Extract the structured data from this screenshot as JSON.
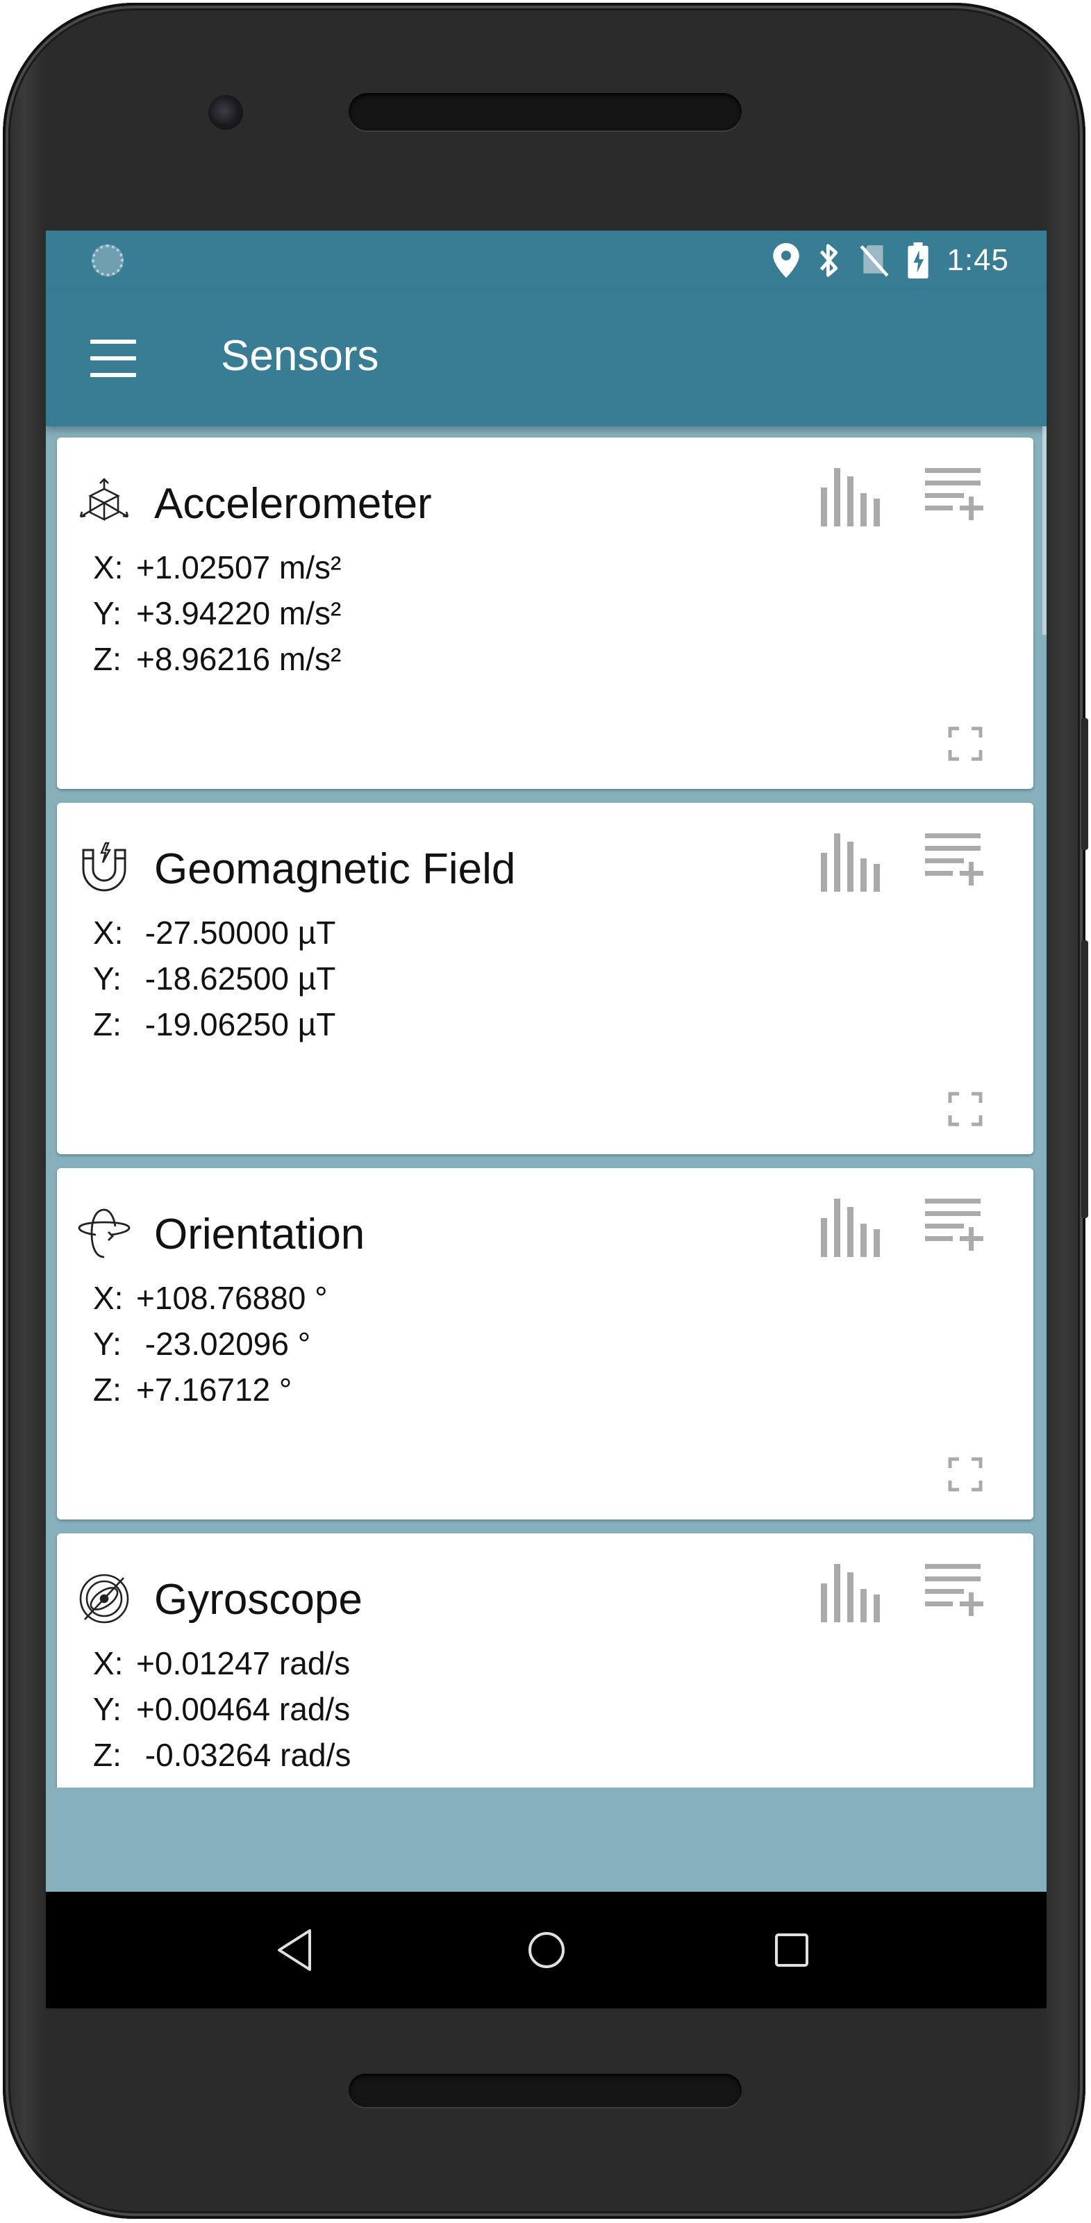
{
  "status_bar": {
    "time": "1:45"
  },
  "app_bar": {
    "title": "Sensors"
  },
  "sensors": [
    {
      "name": "Accelerometer",
      "icon": "cube-axes-icon",
      "rows": [
        {
          "axis": "X:",
          "value": "+1.02507 m/s²"
        },
        {
          "axis": "Y:",
          "value": "+3.94220 m/s²"
        },
        {
          "axis": "Z:",
          "value": "+8.96216 m/s²"
        }
      ]
    },
    {
      "name": "Geomagnetic Field",
      "icon": "magnet-icon",
      "rows": [
        {
          "axis": "X:",
          "value": " -27.50000 µT"
        },
        {
          "axis": "Y:",
          "value": " -18.62500 µT"
        },
        {
          "axis": "Z:",
          "value": " -19.06250 µT"
        }
      ]
    },
    {
      "name": "Orientation",
      "icon": "rotation-icon",
      "rows": [
        {
          "axis": "X:",
          "value": "+108.76880 °"
        },
        {
          "axis": "Y:",
          "value": " -23.02096 °"
        },
        {
          "axis": "Z:",
          "value": "+7.16712 °"
        }
      ]
    },
    {
      "name": "Gyroscope",
      "icon": "gyroscope-icon",
      "rows": [
        {
          "axis": "X:",
          "value": "+0.01247 rad/s"
        },
        {
          "axis": "Y:",
          "value": "+0.00464 rad/s"
        },
        {
          "axis": "Z:",
          "value": " -0.03264 rad/s"
        }
      ]
    }
  ],
  "colors": {
    "primary": "#387d94",
    "background": "#86b0bc",
    "card": "#ffffff",
    "action_icon": "#aaaaaa"
  },
  "icons": {
    "status": [
      "location-icon",
      "bluetooth-icon",
      "no-sim-icon",
      "battery-charging-icon"
    ],
    "card_actions": [
      "bar-chart-icon",
      "playlist-add-icon",
      "fullscreen-icon"
    ],
    "nav": [
      "back-icon",
      "home-icon",
      "recents-icon"
    ]
  }
}
